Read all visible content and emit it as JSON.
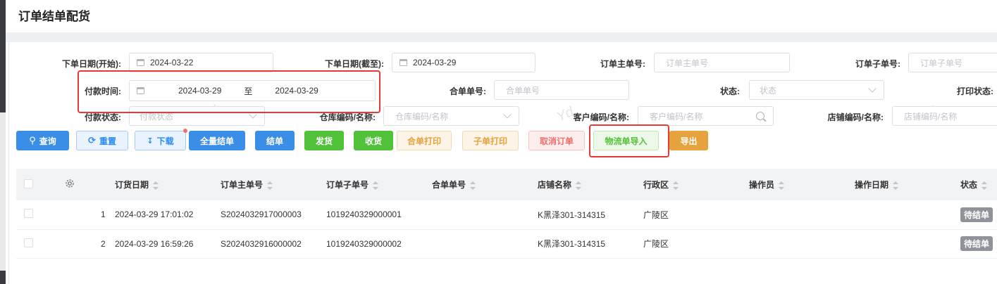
{
  "page_title": "订单结单配货",
  "filters": {
    "order_date_start": {
      "label": "下单日期(开始):",
      "value": "2024-03-22"
    },
    "order_date_end": {
      "label": "下单日期(截至):",
      "value": "2024-03-29"
    },
    "main_order_no": {
      "label": "订单主单号:",
      "placeholder": "订单主单号"
    },
    "sub_order_no": {
      "label": "订单子单号:",
      "placeholder": "订单子单号"
    },
    "pay_time": {
      "label": "付款时间:",
      "start": "2024-03-29",
      "separator": "至",
      "end": "2024-03-29"
    },
    "merge_no": {
      "label": "合单单号:",
      "placeholder": "合单单号"
    },
    "status": {
      "label": "状态:",
      "placeholder": "状态"
    },
    "print_status": {
      "label": "打印状态:"
    },
    "pay_status": {
      "label": "付款状态:",
      "placeholder": "付款状态"
    },
    "warehouse": {
      "label": "仓库编码/名称:",
      "placeholder": "仓库编码/名称"
    },
    "customer": {
      "label": "客户编码/名称:",
      "placeholder": "客户编码/名称"
    },
    "store": {
      "label": "店铺编码/名称:",
      "placeholder": "店铺编码/名称"
    },
    "watermark": "Yd"
  },
  "toolbar": {
    "query": "查询",
    "reset": "重置",
    "download": "下载",
    "settle_all": "全量结单",
    "settle": "结单",
    "ship": "发货",
    "receive": "收货",
    "merge_print": "合单打印",
    "sub_print": "子单打印",
    "cancel_order": "取消订单",
    "logistics_import": "物流单导入",
    "export": "导出"
  },
  "table": {
    "columns": [
      "订货日期",
      "订单主单号",
      "订单子单号",
      "合单单号",
      "店铺名称",
      "行政区",
      "操作员",
      "操作日期",
      "状态"
    ],
    "rows": [
      {
        "index": "1",
        "order_date": "2024-03-29 17:01:02",
        "main_no": "S2024032917000003",
        "sub_no": "1019240329000001",
        "merge_no": "",
        "store": "K黑泽301-314315",
        "district": "广陵区",
        "operator": "",
        "op_date": "",
        "status": "待结单"
      },
      {
        "index": "2",
        "order_date": "2024-03-29 16:59:26",
        "main_no": "S2024032916000002",
        "sub_no": "1019240329000002",
        "merge_no": "",
        "store": "K黑泽301-314315",
        "district": "广陵区",
        "operator": "",
        "op_date": "",
        "status": "待结单"
      }
    ]
  },
  "colors": {
    "primary": "#3a8ee6",
    "success": "#52c23a",
    "warning": "#e6a23c",
    "danger": "#f56c6c",
    "highlight": "#e53935"
  }
}
